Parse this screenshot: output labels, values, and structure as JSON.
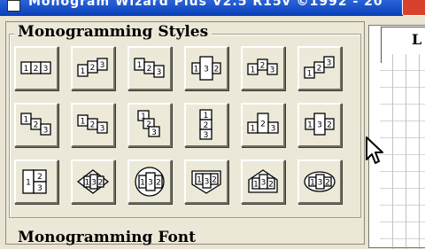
{
  "window": {
    "title": "Monogram Wizard Plus V2.5 R15v ©1992 - 20",
    "icon": "app-window-icon"
  },
  "styles_section": {
    "title": "Monogramming Styles",
    "buttons": [
      {
        "name": "style-flat-row",
        "letters": [
          "1",
          "2",
          "3"
        ]
      },
      {
        "name": "style-banner-wave",
        "letters": [
          "1",
          "2",
          "3"
        ]
      },
      {
        "name": "style-banner-down",
        "letters": [
          "1",
          "2",
          "3"
        ]
      },
      {
        "name": "style-large-center",
        "letters": [
          "1",
          "3",
          "2"
        ]
      },
      {
        "name": "style-arc-up",
        "letters": [
          "1",
          "2",
          "3"
        ]
      },
      {
        "name": "style-stair-up",
        "letters": [
          "1",
          "2",
          "3"
        ]
      },
      {
        "name": "style-stair-down",
        "letters": [
          "1",
          "2",
          "3"
        ]
      },
      {
        "name": "style-banner-twist",
        "letters": [
          "1",
          "2",
          "3"
        ]
      },
      {
        "name": "style-diagonal-stack",
        "letters": [
          "1",
          "2",
          "3"
        ]
      },
      {
        "name": "style-vertical-stack",
        "letters": [
          "1",
          "2",
          "3"
        ]
      },
      {
        "name": "style-center-tall",
        "letters": [
          "1",
          "2",
          "3"
        ]
      },
      {
        "name": "style-center-tall-2",
        "letters": [
          "1",
          "3",
          "2"
        ]
      },
      {
        "name": "style-block-stack",
        "letters": [
          "1",
          "2",
          "3"
        ]
      },
      {
        "name": "style-diamond",
        "letters": [
          "1",
          "3",
          "2"
        ]
      },
      {
        "name": "style-circle",
        "letters": [
          "1",
          "3",
          "2"
        ]
      },
      {
        "name": "style-shield",
        "letters": [
          "1",
          "3",
          "2"
        ]
      },
      {
        "name": "style-house",
        "letters": [
          "1",
          "3",
          "2"
        ]
      },
      {
        "name": "style-ellipse",
        "letters": [
          "1",
          "3",
          "2"
        ]
      }
    ]
  },
  "font_section": {
    "title": "Monogramming Font"
  },
  "side_panel": {
    "label": "L"
  }
}
